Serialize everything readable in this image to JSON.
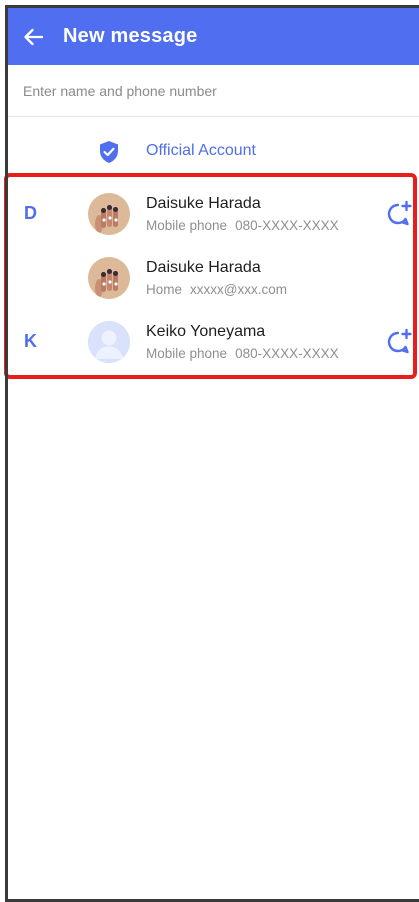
{
  "header": {
    "title": "New message"
  },
  "search": {
    "placeholder": "Enter name and phone number"
  },
  "official": {
    "label": "Official Account"
  },
  "contacts": [
    {
      "section": "D",
      "name": "Daisuke Harada",
      "type": "Mobile phone",
      "value": "080-XXXX-XXXX",
      "avatar": "photo-avatar",
      "chat_add": true
    },
    {
      "section": "",
      "name": "Daisuke Harada",
      "type": "Home",
      "value": "xxxxx@xxx.com",
      "avatar": "photo-avatar",
      "chat_add": false
    },
    {
      "section": "K",
      "name": "Keiko Yoneyama",
      "type": "Mobile phone",
      "value": "080-XXXX-XXXX",
      "avatar": "default-avatar",
      "chat_add": true
    }
  ],
  "colors": {
    "accent": "#4f6ef0",
    "highlight": "#ea1d1d"
  }
}
